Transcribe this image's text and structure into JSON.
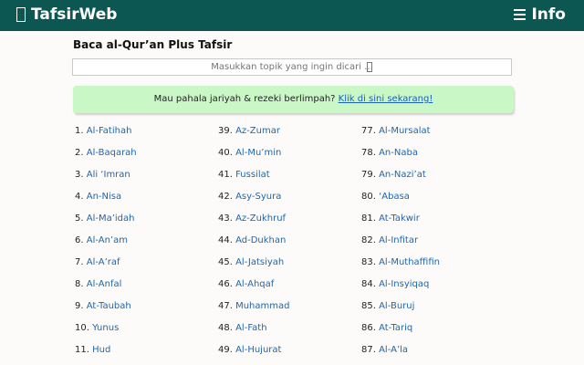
{
  "header": {
    "brand": "TafsirWeb",
    "info": "Info"
  },
  "main": {
    "title": "Baca al-Qur’an Plus Tafsir",
    "search_placeholder": "Masukkan topik yang ingin dicari ...",
    "promo_text": "Mau pahala jariyah & rezeki berlimpah?",
    "promo_link": "Klik di sini sekarang!"
  },
  "surah_columns": [
    [
      {
        "num": "1.",
        "name": "Al-Fatihah"
      },
      {
        "num": "2.",
        "name": "Al-Baqarah"
      },
      {
        "num": "3.",
        "name": "Ali ‘Imran"
      },
      {
        "num": "4.",
        "name": "An-Nisa"
      },
      {
        "num": "5.",
        "name": "Al-Ma’idah"
      },
      {
        "num": "6.",
        "name": "Al-An’am"
      },
      {
        "num": "7.",
        "name": "Al-A’raf"
      },
      {
        "num": "8.",
        "name": "Al-Anfal"
      },
      {
        "num": "9.",
        "name": "At-Taubah"
      },
      {
        "num": "10.",
        "name": "Yunus"
      },
      {
        "num": "11.",
        "name": "Hud"
      }
    ],
    [
      {
        "num": "39.",
        "name": "Az-Zumar"
      },
      {
        "num": "40.",
        "name": "Al-Mu’min"
      },
      {
        "num": "41.",
        "name": "Fussilat"
      },
      {
        "num": "42.",
        "name": "Asy-Syura"
      },
      {
        "num": "43.",
        "name": "Az-Zukhruf"
      },
      {
        "num": "44.",
        "name": "Ad-Dukhan"
      },
      {
        "num": "45.",
        "name": "Al-Jatsiyah"
      },
      {
        "num": "46.",
        "name": "Al-Ahqaf"
      },
      {
        "num": "47.",
        "name": "Muhammad"
      },
      {
        "num": "48.",
        "name": "Al-Fath"
      },
      {
        "num": "49.",
        "name": "Al-Hujurat"
      }
    ],
    [
      {
        "num": "77.",
        "name": "Al-Mursalat"
      },
      {
        "num": "78.",
        "name": "An-Naba"
      },
      {
        "num": "79.",
        "name": "An-Nazi’at"
      },
      {
        "num": "80.",
        "name": "‘Abasa"
      },
      {
        "num": "81.",
        "name": "At-Takwir"
      },
      {
        "num": "82.",
        "name": "Al-Infitar"
      },
      {
        "num": "83.",
        "name": "Al-Muthaffifin"
      },
      {
        "num": "84.",
        "name": "Al-Insyiqaq"
      },
      {
        "num": "85.",
        "name": "Al-Buruj"
      },
      {
        "num": "86.",
        "name": "At-Tariq"
      },
      {
        "num": "87.",
        "name": "Al-A’la"
      }
    ]
  ],
  "colors": {
    "header_bg": "#0d5752",
    "promo_bg": "#caf7c6",
    "link": "#1c67b0"
  }
}
